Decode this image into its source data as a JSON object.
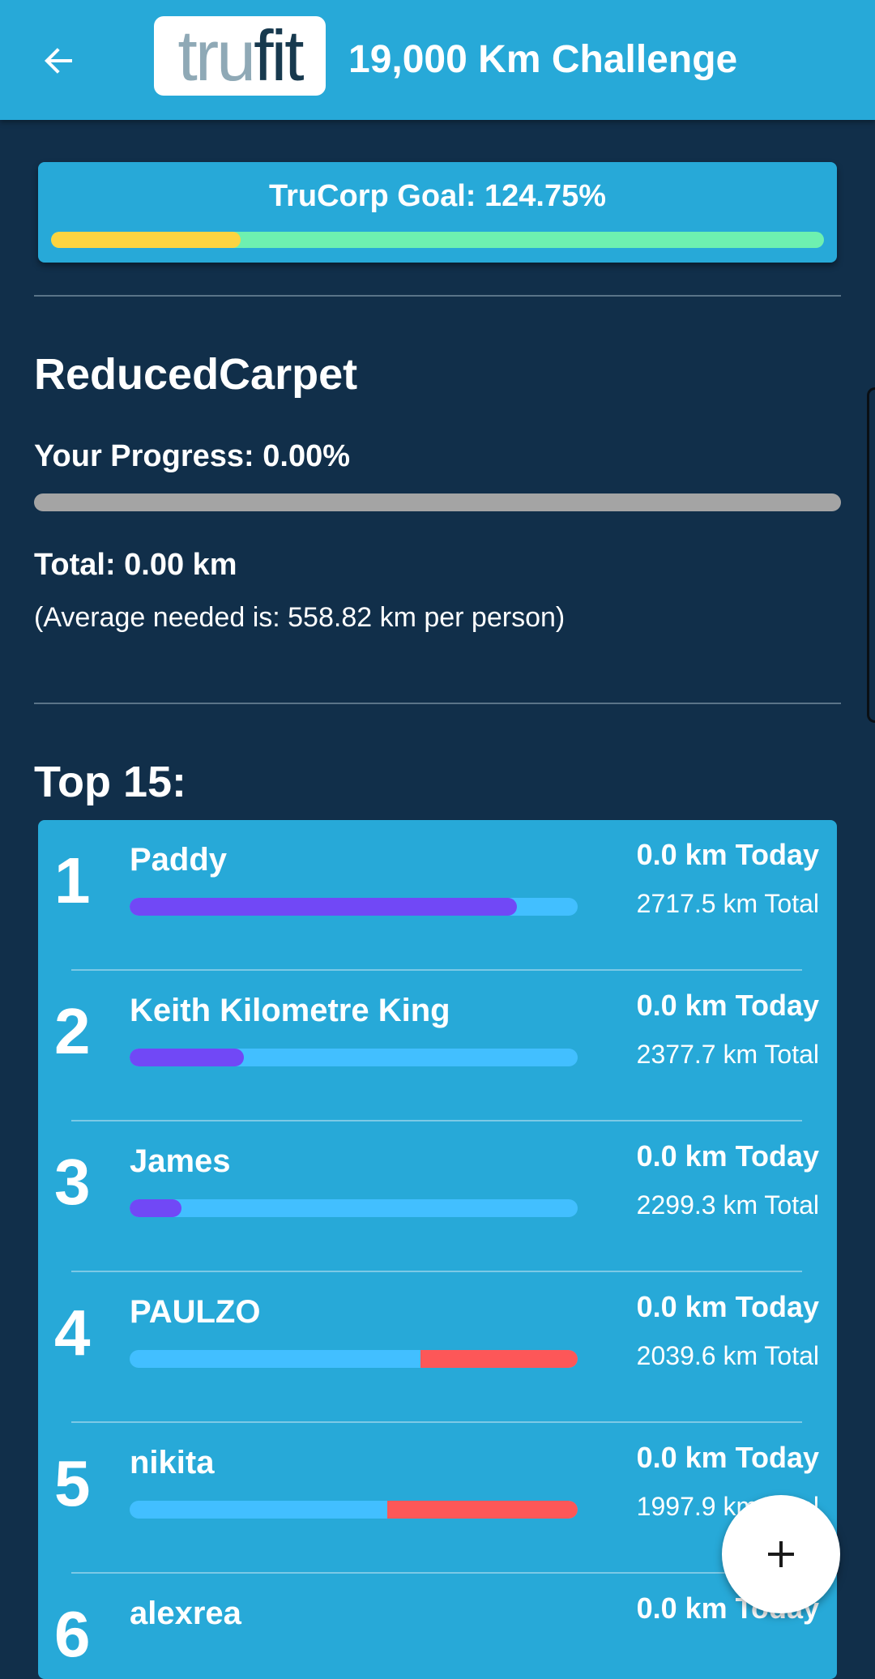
{
  "app_bar": {
    "logo_part1": "tru",
    "logo_part2": "fit",
    "title": "19,000 Km Challenge"
  },
  "goal": {
    "label": "TruCorp Goal: 124.75%",
    "progress_fraction": 0.245
  },
  "user": {
    "name": "ReducedCarpet",
    "progress_label": "Your Progress: 0.00%",
    "progress_fraction": 0.0,
    "total_label": "Total: 0.00 km",
    "average_label": "(Average needed is: 558.82 km per person)"
  },
  "leaderboard": {
    "title": "Top 15:",
    "rows": [
      {
        "rank": "1",
        "name": "Paddy",
        "today": "0.0 km Today",
        "total": "2717.5 km Total",
        "fill_color": "purple",
        "fill_fraction": 0.865
      },
      {
        "rank": "2",
        "name": "Keith Kilometre King",
        "today": "0.0 km Today",
        "total": "2377.7 km Total",
        "fill_color": "purple",
        "fill_fraction": 0.255
      },
      {
        "rank": "3",
        "name": "James",
        "today": "0.0 km Today",
        "total": "2299.3 km Total",
        "fill_color": "purple",
        "fill_fraction": 0.115
      },
      {
        "rank": "4",
        "name": "PAULZO",
        "today": "0.0 km Today",
        "total": "2039.6 km Total",
        "fill_color": "red",
        "fill_fraction": 0.35
      },
      {
        "rank": "5",
        "name": "nikita",
        "today": "0.0 km Today",
        "total": "1997.9 km Total",
        "fill_color": "red",
        "fill_fraction": 0.425
      },
      {
        "rank": "6",
        "name": "alexrea",
        "today": "0.0 km Today",
        "total": "",
        "fill_color": "none",
        "fill_fraction": 0
      }
    ]
  },
  "colors": {
    "app_bar": "#27a9d8",
    "background": "#112f4a",
    "goal_fill": "#fcd441",
    "goal_track": "#6ef0b0",
    "bar_track": "#42bfff",
    "purple": "#7148f6",
    "red": "#fd5758"
  },
  "icons": {
    "back": "arrow-left-icon",
    "fab": "plus-icon"
  }
}
